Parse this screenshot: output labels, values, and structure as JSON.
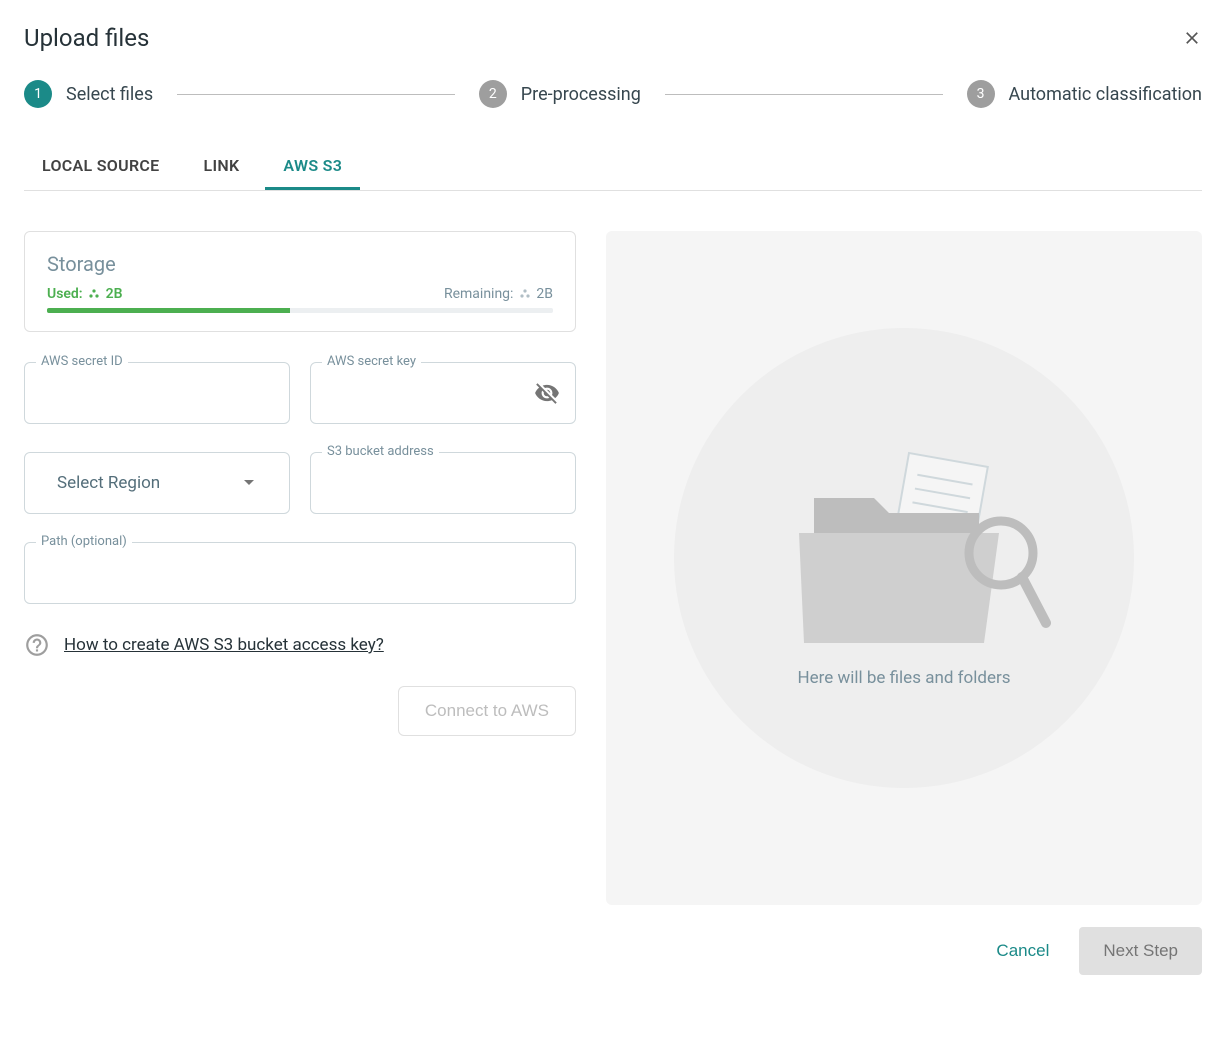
{
  "header": {
    "title": "Upload files"
  },
  "stepper": {
    "steps": [
      {
        "num": "1",
        "label": "Select files",
        "active": true
      },
      {
        "num": "2",
        "label": "Pre-processing",
        "active": false
      },
      {
        "num": "3",
        "label": "Automatic classification",
        "active": false
      }
    ]
  },
  "tabs": {
    "items": [
      {
        "label": "LOCAL SOURCE",
        "active": false
      },
      {
        "label": "LINK",
        "active": false
      },
      {
        "label": "AWS S3",
        "active": true
      }
    ]
  },
  "storage": {
    "title": "Storage",
    "used_label": "Used:",
    "used_value": "2B",
    "remaining_label": "Remaining:",
    "remaining_value": "2B"
  },
  "form": {
    "secret_id_label": "AWS secret ID",
    "secret_key_label": "AWS secret key",
    "region_placeholder": "Select Region",
    "bucket_label": "S3 bucket address",
    "path_label": "Path (optional)",
    "help_text": "How to create AWS S3 bucket access key?",
    "connect_label": "Connect to AWS"
  },
  "preview": {
    "placeholder": "Here will be files and folders"
  },
  "footer": {
    "cancel": "Cancel",
    "next": "Next Step"
  }
}
